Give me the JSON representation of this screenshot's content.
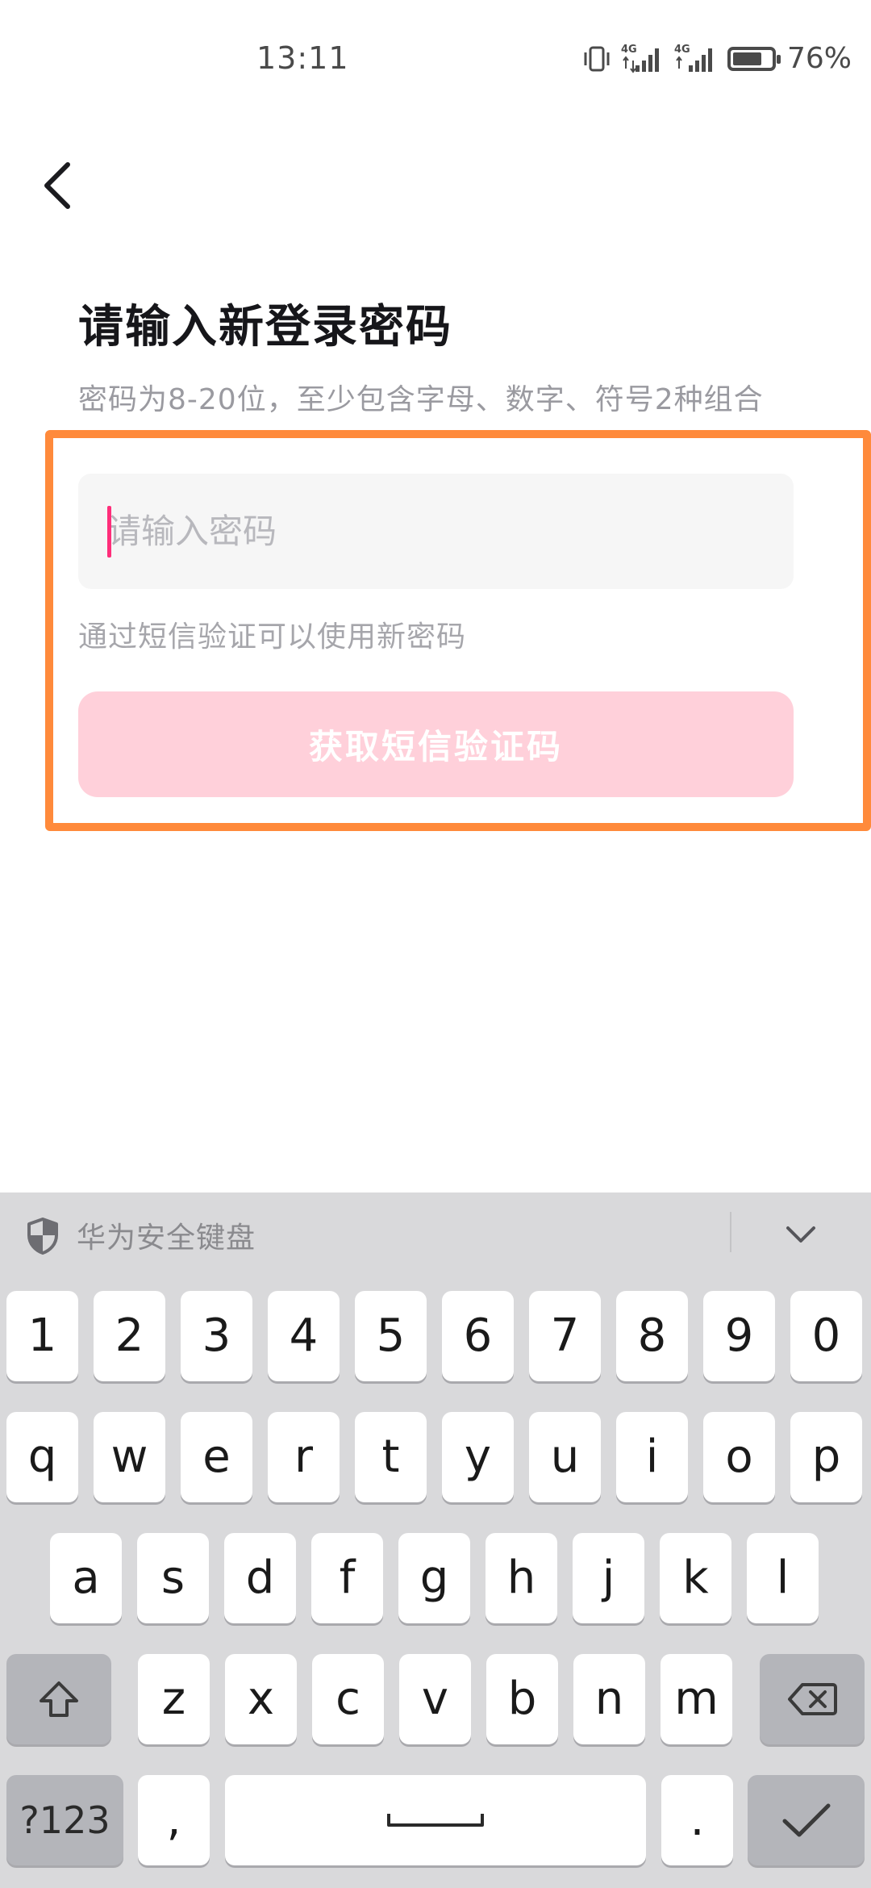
{
  "status_bar": {
    "time": "13:11",
    "network_1": "4G",
    "network_2": "4G",
    "battery_percent_text": "76%",
    "battery_level": 0.76
  },
  "page": {
    "title": "请输入新登录密码",
    "subtitle": "密码为8-20位，至少包含字母、数字、符号2种组合",
    "password_placeholder": "请输入密码",
    "password_value": "",
    "hint": "通过短信验证可以使用新密码",
    "sms_button_label": "获取短信验证码"
  },
  "colors": {
    "highlight_border": "#ff8a3b",
    "button_disabled_bg": "#ffd0da",
    "caret": "#ff2e7a"
  },
  "keyboard": {
    "brand": "华为安全键盘",
    "row_numbers": [
      "1",
      "2",
      "3",
      "4",
      "5",
      "6",
      "7",
      "8",
      "9",
      "0"
    ],
    "row_1": [
      "q",
      "w",
      "e",
      "r",
      "t",
      "y",
      "u",
      "i",
      "o",
      "p"
    ],
    "row_2": [
      "a",
      "s",
      "d",
      "f",
      "g",
      "h",
      "j",
      "k",
      "l"
    ],
    "row_3": [
      "z",
      "x",
      "c",
      "v",
      "b",
      "n",
      "m"
    ],
    "symbols_label": "?123",
    "comma_label": ",",
    "period_label": ".",
    "icons": {
      "brand": "shield-icon",
      "collapse": "chevron-down-icon",
      "shift": "shift-icon",
      "backspace": "backspace-icon",
      "space": "space-icon",
      "confirm": "check-icon"
    }
  }
}
